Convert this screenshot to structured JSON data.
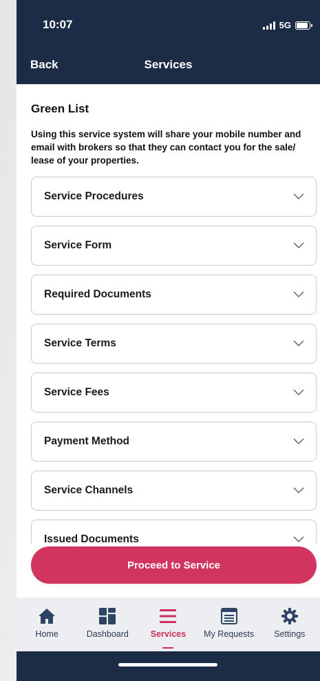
{
  "status": {
    "time": "10:07",
    "network": "5G"
  },
  "nav": {
    "back_label": "Back",
    "title": "Services"
  },
  "content": {
    "section_title": "Green List",
    "description": "Using this service system will share your mobile number and email with brokers so that they can contact you for the sale/ lease of your properties.",
    "accordions": [
      "Service Procedures",
      "Service Form",
      "Required Documents",
      "Service Terms",
      "Service Fees",
      "Payment Method",
      "Service Channels",
      "Issued Documents"
    ]
  },
  "proceed_label": "Proceed to Service",
  "tabs": [
    {
      "label": "Home",
      "icon": "home-icon"
    },
    {
      "label": "Dashboard",
      "icon": "dashboard-icon"
    },
    {
      "label": "Services",
      "icon": "menu-icon",
      "active": true
    },
    {
      "label": "My Requests",
      "icon": "requests-icon"
    },
    {
      "label": "Settings",
      "icon": "gear-icon"
    }
  ],
  "colors": {
    "navy": "#1c2c46",
    "accent": "#d0345f",
    "tab_bg": "#eceef1"
  }
}
